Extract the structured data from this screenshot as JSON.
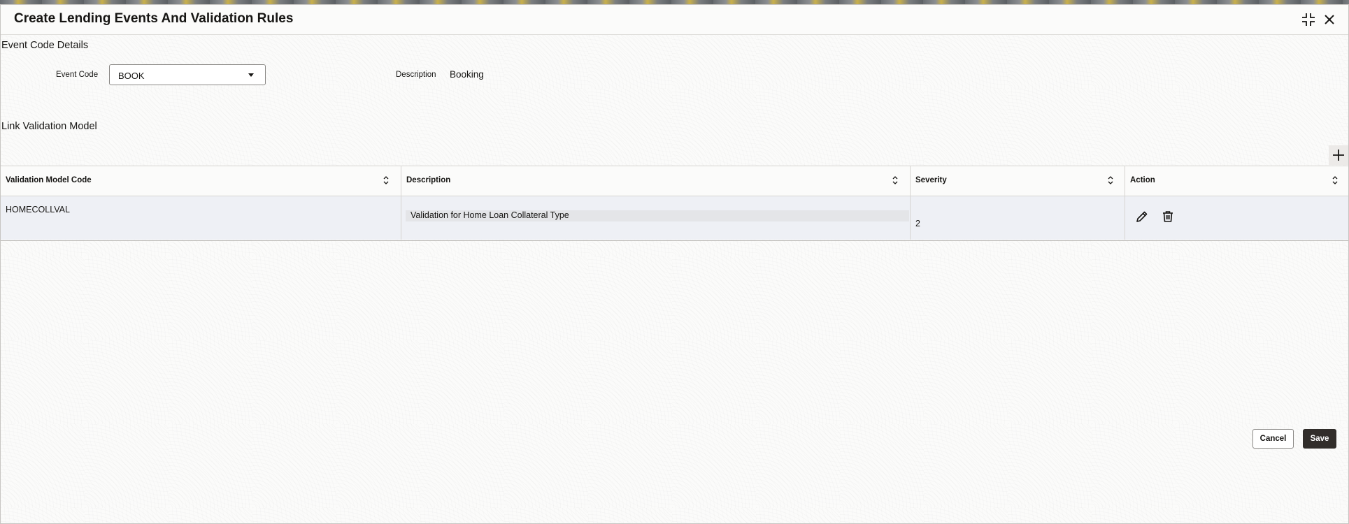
{
  "dialog": {
    "title": "Create Lending Events And Validation Rules",
    "icons": {
      "collapse": "collapse-icon",
      "close": "close-icon"
    }
  },
  "event_code_details": {
    "section_title": "Event Code Details",
    "event_code_label": "Event Code",
    "event_code_value": "BOOK",
    "description_label": "Description",
    "description_value": "Booking"
  },
  "link_validation_model": {
    "section_title": "Link Validation Model",
    "add_icon": "plus-icon",
    "columns": [
      {
        "label": "Validation Model Code"
      },
      {
        "label": "Description"
      },
      {
        "label": "Severity"
      },
      {
        "label": "Action"
      }
    ],
    "rows": [
      {
        "code": "HOMECOLLVAL",
        "description": "Validation for Home Loan Collateral Type",
        "severity": "2",
        "actions": [
          "pencil-icon",
          "trash-icon"
        ]
      }
    ]
  },
  "footer": {
    "cancel_label": "Cancel",
    "save_label": "Save"
  },
  "colors": {
    "primary_button": "#312d2a",
    "row_highlight": "#eef0f5",
    "text": "#161513"
  }
}
